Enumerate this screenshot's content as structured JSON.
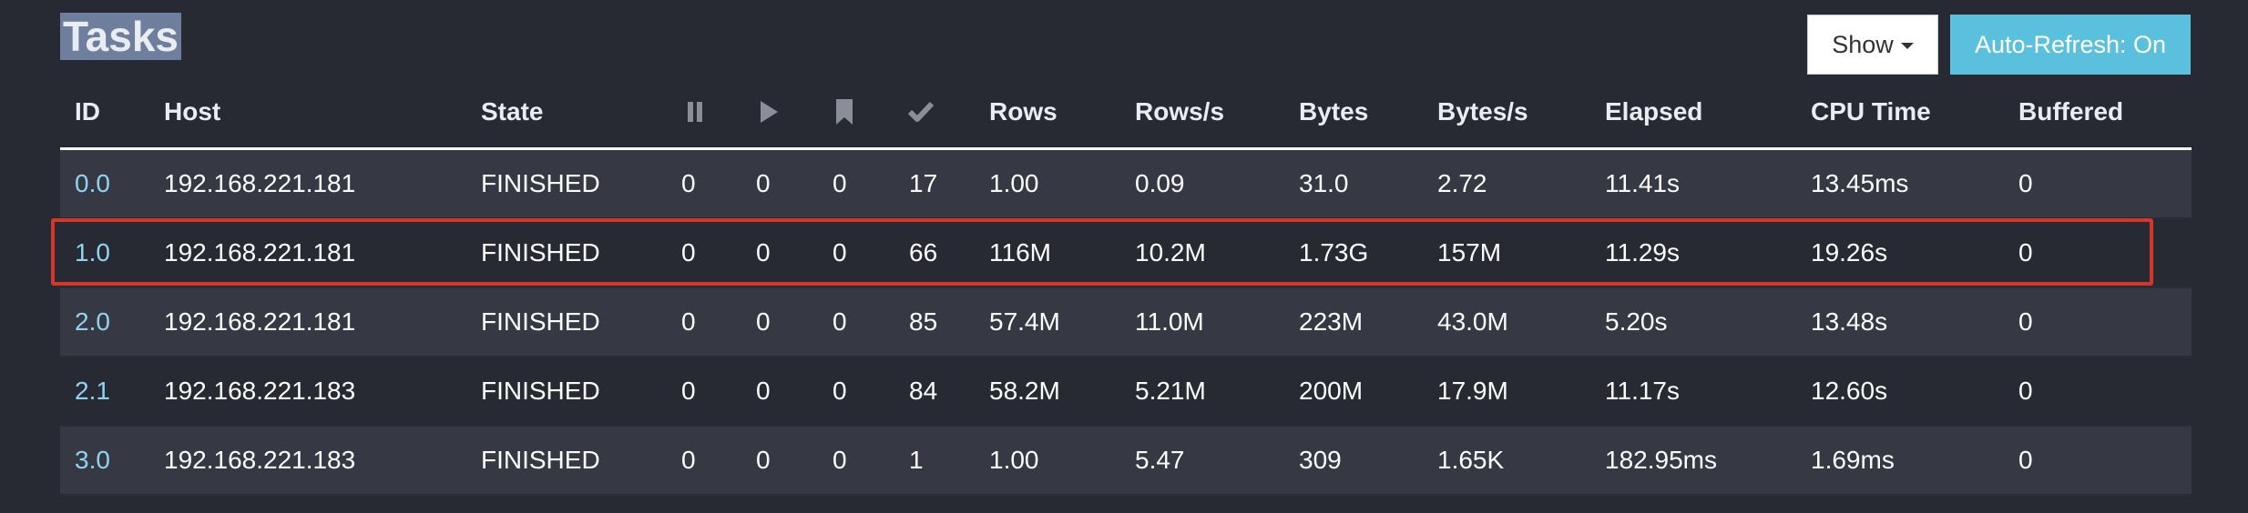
{
  "page": {
    "title": "Tasks"
  },
  "toolbar": {
    "show_label": "Show",
    "refresh_label": "Auto-Refresh: On"
  },
  "table": {
    "headers": {
      "id": "ID",
      "host": "Host",
      "state": "State",
      "rows": "Rows",
      "rows_s": "Rows/s",
      "bytes": "Bytes",
      "bytes_s": "Bytes/s",
      "elapsed": "Elapsed",
      "cpu": "CPU Time",
      "buffered": "Buffered"
    },
    "header_icons": [
      "pause-icon",
      "play-icon",
      "bookmark-icon",
      "check-icon"
    ],
    "rows": [
      {
        "id": "0.0",
        "host": "192.168.221.181",
        "state": "FINISHED",
        "queued": "0",
        "running": "0",
        "blocked": "0",
        "finished": "17",
        "rows": "1.00",
        "rows_s": "0.09",
        "bytes": "31.0",
        "bytes_s": "2.72",
        "elapsed": "11.41s",
        "cpu": "13.45ms",
        "buffered": "0"
      },
      {
        "id": "1.0",
        "host": "192.168.221.181",
        "state": "FINISHED",
        "queued": "0",
        "running": "0",
        "blocked": "0",
        "finished": "66",
        "rows": "116M",
        "rows_s": "10.2M",
        "bytes": "1.73G",
        "bytes_s": "157M",
        "elapsed": "11.29s",
        "cpu": "19.26s",
        "buffered": "0"
      },
      {
        "id": "2.0",
        "host": "192.168.221.181",
        "state": "FINISHED",
        "queued": "0",
        "running": "0",
        "blocked": "0",
        "finished": "85",
        "rows": "57.4M",
        "rows_s": "11.0M",
        "bytes": "223M",
        "bytes_s": "43.0M",
        "elapsed": "5.20s",
        "cpu": "13.48s",
        "buffered": "0"
      },
      {
        "id": "2.1",
        "host": "192.168.221.183",
        "state": "FINISHED",
        "queued": "0",
        "running": "0",
        "blocked": "0",
        "finished": "84",
        "rows": "58.2M",
        "rows_s": "5.21M",
        "bytes": "200M",
        "bytes_s": "17.9M",
        "elapsed": "11.17s",
        "cpu": "12.60s",
        "buffered": "0"
      },
      {
        "id": "3.0",
        "host": "192.168.221.183",
        "state": "FINISHED",
        "queued": "0",
        "running": "0",
        "blocked": "0",
        "finished": "1",
        "rows": "1.00",
        "rows_s": "5.47",
        "bytes": "309",
        "bytes_s": "1.65K",
        "elapsed": "182.95ms",
        "cpu": "1.69ms",
        "buffered": "0"
      }
    ]
  },
  "colors": {
    "background": "#272a33",
    "row_alt": "#363944",
    "link": "#8fd3ef",
    "refresh_button": "#5bc0de",
    "highlight": "#d5362a"
  }
}
